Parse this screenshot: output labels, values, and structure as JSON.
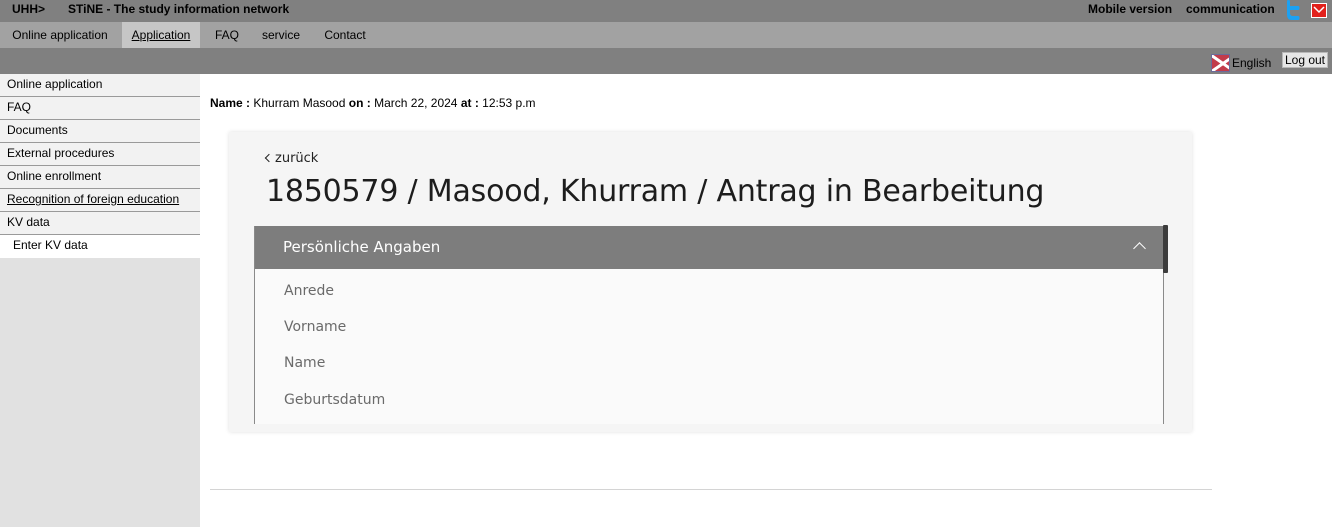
{
  "topbar": {
    "uhh": "UHH>",
    "title": "STiNE - The study information network",
    "mobile_version": "Mobile version",
    "communication": "communication"
  },
  "mainnav": {
    "tabs": [
      {
        "label": "Online application",
        "active": false
      },
      {
        "label": "Application",
        "active": true
      },
      {
        "label": "FAQ",
        "active": false
      },
      {
        "label": "service",
        "active": false
      },
      {
        "label": "Contact",
        "active": false
      }
    ]
  },
  "subbar": {
    "language": "English",
    "logout": "Log out"
  },
  "sidebar": {
    "items": [
      {
        "label": "Online application"
      },
      {
        "label": "FAQ"
      },
      {
        "label": "Documents"
      },
      {
        "label": "External procedures"
      },
      {
        "label": "Online enrollment"
      },
      {
        "label": "Recognition of foreign education"
      },
      {
        "label": "KV data"
      },
      {
        "label": "Enter KV data"
      }
    ]
  },
  "meta": {
    "name_label": "Name :",
    "name_value": "Khurram Masood",
    "on_label": "on :",
    "date_value": "March 22, 2024",
    "at_label": "at :",
    "time_value": "12:53 p.m"
  },
  "card": {
    "back_label": "zurück",
    "title": "1850579 / Masood, Khurram / Antrag in Bearbeitung",
    "section": {
      "title": "Persönliche Angaben",
      "fields": [
        "Anrede",
        "Vorname",
        "Name",
        "Geburtsdatum"
      ]
    }
  },
  "colors": {
    "topbar_bg": "#808080",
    "nav_bg": "#a2a2a2",
    "active_tab_bg": "#c6c6c6",
    "sidebar_bg": "#e1e1e1",
    "section_header_bg": "#7d7d7d",
    "mail_icon": "#e2211c",
    "twitter_icon": "#1da1f2"
  }
}
